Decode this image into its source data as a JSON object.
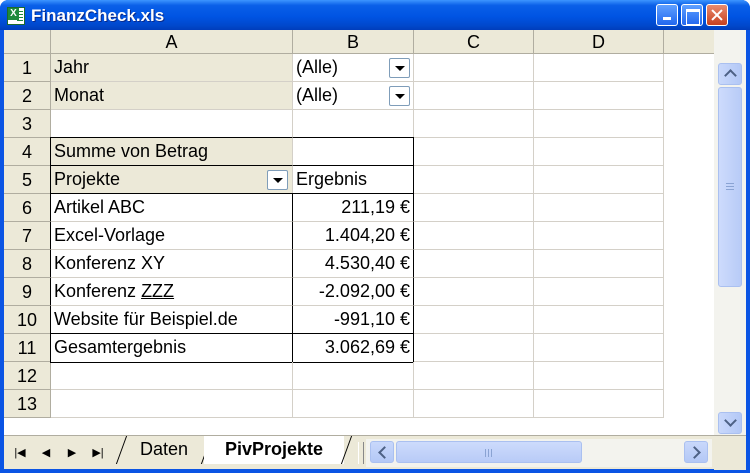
{
  "window": {
    "title": "FinanzCheck.xls"
  },
  "columns": [
    "A",
    "B",
    "C",
    "D"
  ],
  "rows": [
    "1",
    "2",
    "3",
    "4",
    "5",
    "6",
    "7",
    "8",
    "9",
    "10",
    "11",
    "12",
    "13"
  ],
  "filters": [
    {
      "label": "Jahr",
      "value": "(Alle)"
    },
    {
      "label": "Monat",
      "value": "(Alle)"
    }
  ],
  "pivot": {
    "data_field": "Summe von Betrag",
    "row_field": "Projekte",
    "result_header": "Ergebnis",
    "items": [
      {
        "name": "Artikel ABC",
        "value": "211,19 €"
      },
      {
        "name": "Excel-Vorlage",
        "value": "1.404,20 €"
      },
      {
        "name": "Konferenz XY",
        "value": "4.530,40 €"
      },
      {
        "name_prefix": "Konferenz ",
        "name_underlined": "ZZZ",
        "value": "-2.092,00 €"
      },
      {
        "name": "Website für Beispiel.de",
        "value": "-991,10 €"
      }
    ],
    "total": {
      "name": "Gesamtergebnis",
      "value": "3.062,69 €"
    }
  },
  "sheet_tabs": [
    "Daten",
    "PivProjekte"
  ],
  "active_sheet": "PivProjekte",
  "nav_icons": [
    "first-sheet-icon",
    "prev-sheet-icon",
    "next-sheet-icon",
    "last-sheet-icon"
  ],
  "colors": {
    "title_bar": "#0054e3",
    "header_gray": "#ece9d8",
    "close_button": "#c7411f"
  }
}
